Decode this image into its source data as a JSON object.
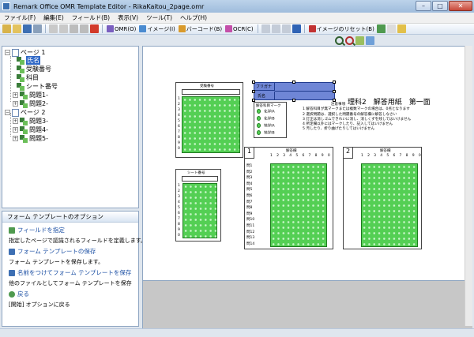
{
  "window": {
    "title": "Remark Office OMR Template Editor - RikaKaitou_2page.omr"
  },
  "menu": [
    "ファイル(F)",
    "編集(E)",
    "フィールド(B)",
    "表示(V)",
    "ツール(T)",
    "ヘルプ(H)"
  ],
  "toolbar": {
    "omr_label": "OMR(O)",
    "image_label": "イメージ(I)",
    "barcode_label": "バーコード(B)",
    "ocr_label": "OCR(C)",
    "image_reset_label": "イメージのリセット(B)"
  },
  "tree": {
    "page1": "ページ 1",
    "page1_items": [
      "氏名",
      "受験番号",
      "科目",
      "シート番号",
      "問題1-",
      "問題2-"
    ],
    "page2": "ページ 2",
    "page2_items": [
      "問題3-",
      "問題4-",
      "問題5-"
    ]
  },
  "options": {
    "title": "フォーム テンプレートのオプション",
    "items": [
      {
        "title": "フィールドを指定",
        "desc": "指定したページで認識されるフィールドを定義します。"
      },
      {
        "title": "フォーム テンプレートの保存",
        "desc": "フォーム テンプレートを保存します。"
      },
      {
        "title": "名前をつけてフォーム テンプレートを保存",
        "desc": "他のファイルとしてフォーム テンプレートを保存"
      },
      {
        "title": "戻る",
        "desc": "[開始] オプションに戻る"
      }
    ]
  },
  "form": {
    "exam_title": "理科2　解答用紙　第一面",
    "furigana_label": "フリガナ",
    "name_label": "氏名",
    "exam_number_label": "受験番号",
    "sheet_number_label": "シート番号",
    "subject_header": "解答科目マーク",
    "subjects": [
      "化学IA",
      "化学IB",
      "地学IA",
      "地学IB"
    ],
    "notes_title": "注意事項",
    "notes": [
      "1 解答科目が無マークまたは複数マークの場合は、0点となります",
      "2 選択問題は、選択した問題番号の解答欄に解答しなさい",
      "3 訂正は消しゴムできれいに消し、消しくずを残してはいけません",
      "4 所定欄以外にはマークしたり、記入してはいけません",
      "5 汚したり、折り曲げたりしてはいけません"
    ],
    "answer_header": "解答欄",
    "block1_number": "1",
    "block2_number": "2",
    "digit_row": "1 2 3 4 5 6 7 8 9 0",
    "question_rows": [
      "問1",
      "問2",
      "問3",
      "問4",
      "問5",
      "問6",
      "問7",
      "問8",
      "問9",
      "問10",
      "問11",
      "問12",
      "問13",
      "問14"
    ],
    "digit_col": [
      "1",
      "2",
      "3",
      "4",
      "5",
      "6",
      "7",
      "8",
      "9",
      "0"
    ]
  }
}
